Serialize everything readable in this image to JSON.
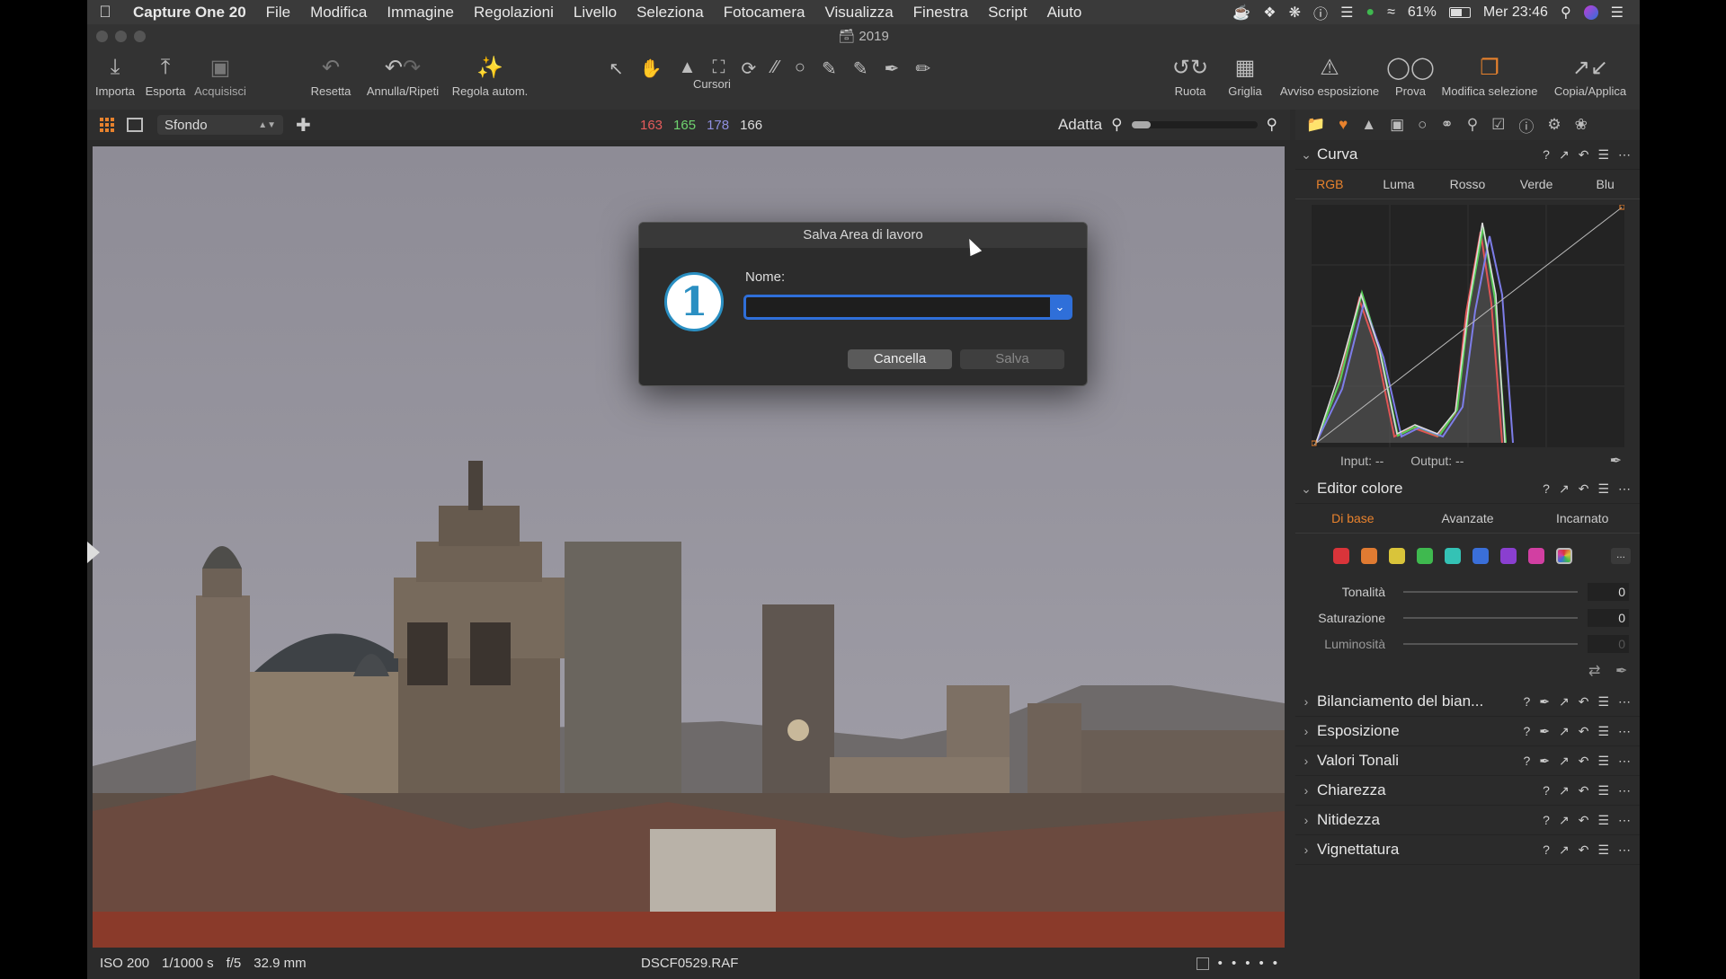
{
  "menubar": {
    "app_name": "Capture One 20",
    "items": [
      "File",
      "Modifica",
      "Immagine",
      "Regolazioni",
      "Livello",
      "Seleziona",
      "Fotocamera",
      "Visualizza",
      "Finestra",
      "Script",
      "Aiuto"
    ],
    "battery": "61%",
    "clock": "Mer 23:46"
  },
  "window": {
    "title": "2019"
  },
  "toolbar": {
    "import": "Importa",
    "export": "Esporta",
    "capture": "Acquisisci",
    "reset": "Resetta",
    "undo_redo": "Annulla/Ripeti",
    "auto_adjust": "Regola autom.",
    "cursors": "Cursori",
    "rotate": "Ruota",
    "grid": "Griglia",
    "exposure_warning": "Avviso esposizione",
    "proof": "Prova",
    "edit_selection": "Modifica selezione",
    "copy_apply": "Copia/Applica"
  },
  "viewerbar": {
    "background_select": "Sfondo",
    "rgb": {
      "r": "163",
      "g": "165",
      "b": "178",
      "l": "166"
    },
    "zoom_label": "Adatta",
    "zoom_level": 0.15
  },
  "statusbar": {
    "iso": "ISO 200",
    "shutter": "1/1000 s",
    "aperture": "f/5",
    "focal": "32.9 mm",
    "filename": "DSCF0529.RAF"
  },
  "dialog": {
    "title": "Salva Area di lavoro",
    "logo_glyph": "1",
    "name_label": "Nome:",
    "name_value": "",
    "cancel": "Cancella",
    "save": "Salva"
  },
  "panel": {
    "curve": {
      "title": "Curva",
      "tabs": [
        "RGB",
        "Luma",
        "Rosso",
        "Verde",
        "Blu"
      ],
      "input": "Input:  --",
      "output": "Output:  --"
    },
    "color_editor": {
      "title": "Editor colore",
      "tabs": [
        "Di base",
        "Avanzate",
        "Incarnato"
      ],
      "swatches": [
        "#d9343a",
        "#e07b32",
        "#d9c43a",
        "#3fb94f",
        "#34c2b5",
        "#3a6fd9",
        "#8a3fd0",
        "#d23fa2"
      ],
      "more": "...",
      "sliders": [
        {
          "label": "Tonalità",
          "value": "0"
        },
        {
          "label": "Saturazione",
          "value": "0"
        },
        {
          "label": "Luminosità",
          "value": "0"
        }
      ]
    },
    "sections": [
      "Bilanciamento del bian...",
      "Esposizione",
      "Valori Tonali",
      "Chiarezza",
      "Nitidezza",
      "Vignettatura"
    ]
  },
  "colors": {
    "accent": "#e8822d",
    "focus": "#2f6fd9"
  }
}
